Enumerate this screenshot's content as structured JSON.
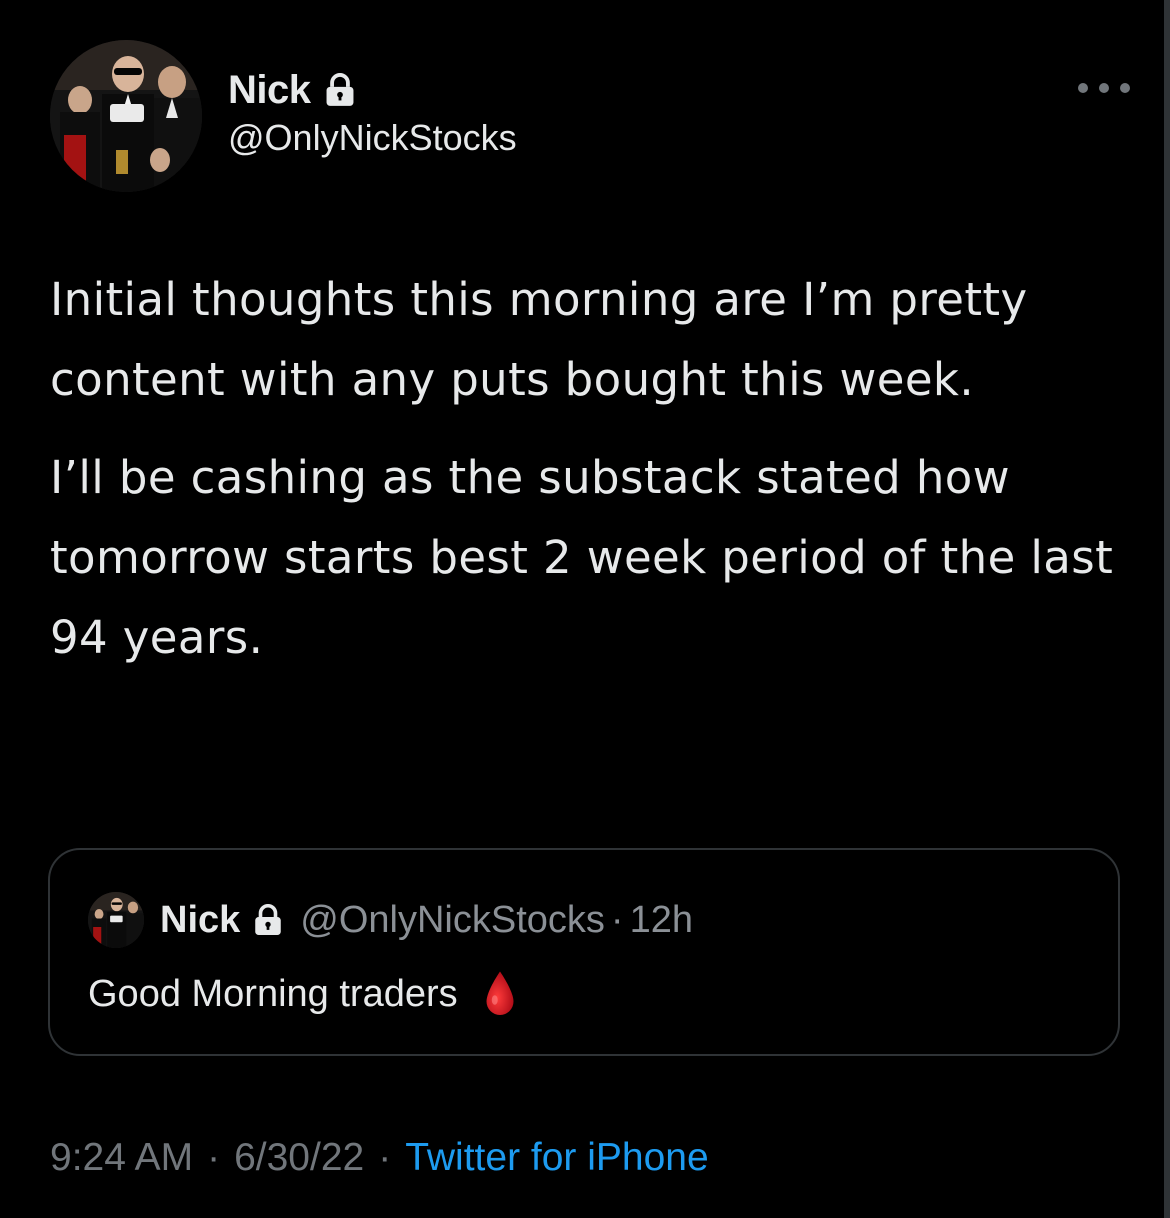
{
  "author": {
    "display_name": "Nick",
    "handle": "@OnlyNickStocks",
    "protected": true,
    "avatar": "avatar-photo"
  },
  "tweet": {
    "paragraphs": [
      "Initial thoughts this morning are I’m pretty content with any puts bought this week.",
      "I’ll be cashing as the substack stated how tomorrow starts best 2 week period of the last 94 years."
    ]
  },
  "quoted_tweet": {
    "display_name": "Nick",
    "handle": "@OnlyNickStocks",
    "separator": "·",
    "time_ago": "12h",
    "text": "Good Morning traders",
    "emoji_icon": "drop-of-blood-icon"
  },
  "meta": {
    "time": "9:24 AM",
    "separator": "·",
    "date": "6/30/22",
    "source": "Twitter for iPhone"
  },
  "colors": {
    "background": "#000000",
    "text_primary": "#e7e9ea",
    "text_secondary": "#71767b",
    "link": "#1d9bf0",
    "border": "#2f3336",
    "blood": "#c1121f"
  },
  "icons": {
    "lock": "lock-icon",
    "more": "more-horizontal-icon"
  }
}
